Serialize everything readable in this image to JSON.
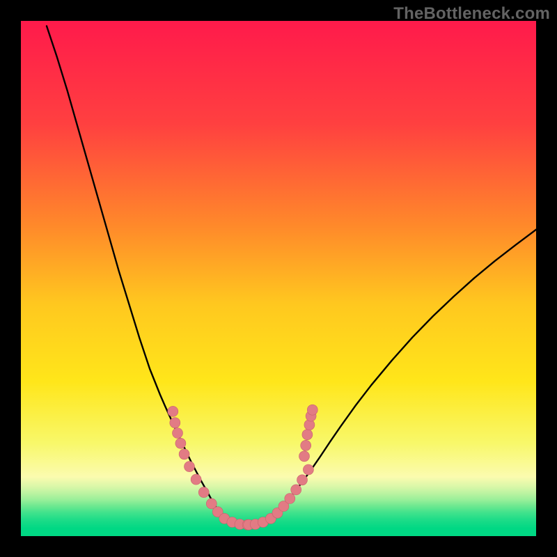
{
  "watermark": "TheBottleneck.com",
  "colors": {
    "gradient_stops": [
      {
        "offset": 0.0,
        "color": "#ff1a4b"
      },
      {
        "offset": 0.2,
        "color": "#ff4040"
      },
      {
        "offset": 0.4,
        "color": "#ff8a2a"
      },
      {
        "offset": 0.55,
        "color": "#ffc81f"
      },
      {
        "offset": 0.7,
        "color": "#ffe61a"
      },
      {
        "offset": 0.82,
        "color": "#f8f86a"
      },
      {
        "offset": 0.885,
        "color": "#fbfbaf"
      },
      {
        "offset": 0.905,
        "color": "#d7f7a8"
      },
      {
        "offset": 0.918,
        "color": "#b8f3a0"
      },
      {
        "offset": 0.93,
        "color": "#97ef99"
      },
      {
        "offset": 0.942,
        "color": "#6ce890"
      },
      {
        "offset": 0.955,
        "color": "#3fe28c"
      },
      {
        "offset": 0.968,
        "color": "#1edc88"
      },
      {
        "offset": 0.985,
        "color": "#00d884"
      },
      {
        "offset": 1.0,
        "color": "#00d884"
      }
    ],
    "curve": "#000000",
    "marker_fill": "#e27b84",
    "marker_stroke": "#c8626c"
  },
  "chart_data": {
    "type": "line",
    "title": "",
    "xlabel": "",
    "ylabel": "",
    "xlim": [
      0,
      100
    ],
    "ylim": [
      0,
      100
    ],
    "series": [
      {
        "name": "curve_left",
        "x": [
          5,
          7,
          9,
          11,
          13,
          15,
          17,
          19,
          21,
          23,
          25,
          27,
          28,
          29,
          30,
          31,
          32,
          33,
          34,
          35,
          36,
          37,
          38,
          39
        ],
        "y": [
          99,
          93,
          86.5,
          79.5,
          72.5,
          65.5,
          58.5,
          51.5,
          45,
          38.5,
          32.5,
          27.5,
          25.2,
          23,
          20.8,
          18.7,
          16.6,
          14.5,
          12.6,
          10.7,
          8.9,
          7.1,
          5.4,
          3.8
        ]
      },
      {
        "name": "curve_bottom",
        "x": [
          39,
          40,
          41,
          42,
          43,
          44,
          45,
          46,
          47,
          48,
          49,
          50
        ],
        "y": [
          3.8,
          3.2,
          2.7,
          2.4,
          2.25,
          2.2,
          2.25,
          2.45,
          2.8,
          3.35,
          4.1,
          5.0
        ]
      },
      {
        "name": "curve_right",
        "x": [
          50,
          52,
          54,
          56,
          58,
          60,
          62,
          65,
          68,
          72,
          76,
          80,
          84,
          88,
          92,
          96,
          100
        ],
        "y": [
          5.0,
          7.2,
          9.7,
          12.4,
          15.3,
          18.3,
          21.2,
          25.4,
          29.3,
          34.1,
          38.6,
          42.7,
          46.5,
          50.1,
          53.4,
          56.5,
          59.5
        ]
      }
    ],
    "markers": [
      {
        "x": 29.5,
        "y": 24.2
      },
      {
        "x": 29.9,
        "y": 22.0
      },
      {
        "x": 30.4,
        "y": 20.0
      },
      {
        "x": 31.0,
        "y": 18.0
      },
      {
        "x": 31.7,
        "y": 15.9
      },
      {
        "x": 32.7,
        "y": 13.5
      },
      {
        "x": 34.0,
        "y": 11.0
      },
      {
        "x": 35.5,
        "y": 8.5
      },
      {
        "x": 37.0,
        "y": 6.3
      },
      {
        "x": 38.2,
        "y": 4.7
      },
      {
        "x": 39.5,
        "y": 3.4
      },
      {
        "x": 41.0,
        "y": 2.7
      },
      {
        "x": 42.5,
        "y": 2.3
      },
      {
        "x": 44.0,
        "y": 2.2
      },
      {
        "x": 44.2,
        "y": 2.2
      },
      {
        "x": 45.5,
        "y": 2.3
      },
      {
        "x": 47.0,
        "y": 2.7
      },
      {
        "x": 48.5,
        "y": 3.4
      },
      {
        "x": 49.8,
        "y": 4.5
      },
      {
        "x": 51.0,
        "y": 5.8
      },
      {
        "x": 52.2,
        "y": 7.3
      },
      {
        "x": 53.4,
        "y": 9.0
      },
      {
        "x": 54.6,
        "y": 10.9
      },
      {
        "x": 55.8,
        "y": 12.9
      },
      {
        "x": 55.0,
        "y": 15.5
      },
      {
        "x": 55.3,
        "y": 17.6
      },
      {
        "x": 55.6,
        "y": 19.7
      },
      {
        "x": 56.0,
        "y": 21.6
      },
      {
        "x": 56.3,
        "y": 23.3
      },
      {
        "x": 56.6,
        "y": 24.5
      }
    ]
  }
}
